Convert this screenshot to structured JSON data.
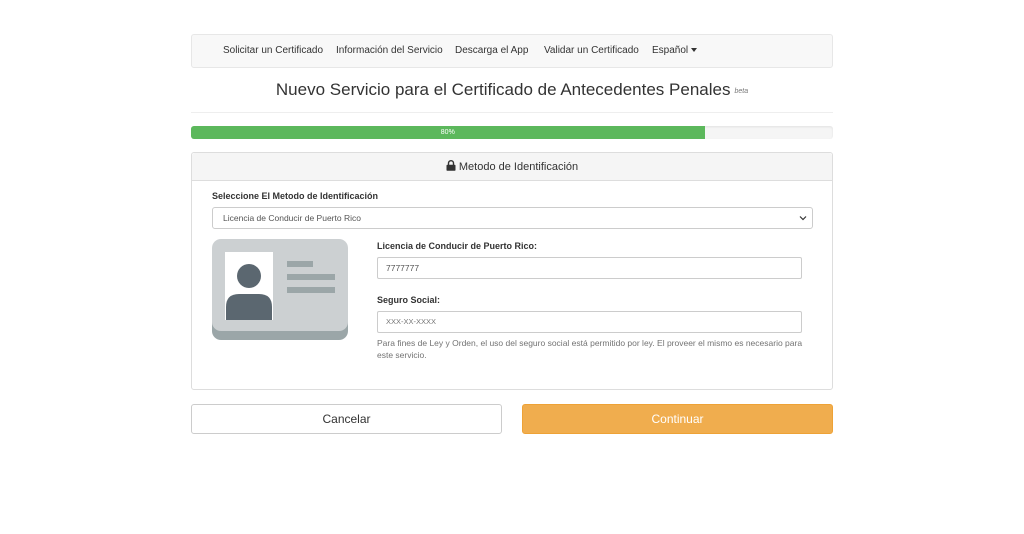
{
  "nav": {
    "items": [
      {
        "label": "Solicitar un Certificado"
      },
      {
        "label": "Información del Servicio"
      },
      {
        "label": "Descarga el App"
      },
      {
        "label": "Validar un Certificado"
      },
      {
        "label": "Español"
      }
    ]
  },
  "page": {
    "title": "Nuevo Servicio para el Certificado de Antecedentes Penales",
    "badge": "beta"
  },
  "progress": {
    "value": 0.8,
    "label": "80%"
  },
  "panel": {
    "heading": "Metodo de Identificación",
    "select_label": "Seleccione El Metodo de Identificación",
    "select_value": "Licencia de Conducir de Puerto Rico",
    "license_label": "Licencia de Conducir de Puerto Rico:",
    "license_value": "7777777",
    "ssn_label": "Seguro Social:",
    "ssn_placeholder": "XXX-XX-XXXX",
    "help_text": "Para fines de Ley y Orden, el uso del seguro social está permitido por ley. El proveer el mismo es necesario para este servicio."
  },
  "buttons": {
    "cancel": "Cancelar",
    "continue": "Continuar"
  },
  "colors": {
    "progress": "#5cb85c",
    "primary_action": "#f0ad4e",
    "card_bg": "#ccd0d2",
    "card_dark": "#5b6770",
    "card_shadow": "#9ba6a8"
  },
  "icons": {
    "heading": "lock-icon",
    "select": "chevron-down-icon",
    "illustration": "id-card-icon",
    "language": "caret-down-icon"
  }
}
